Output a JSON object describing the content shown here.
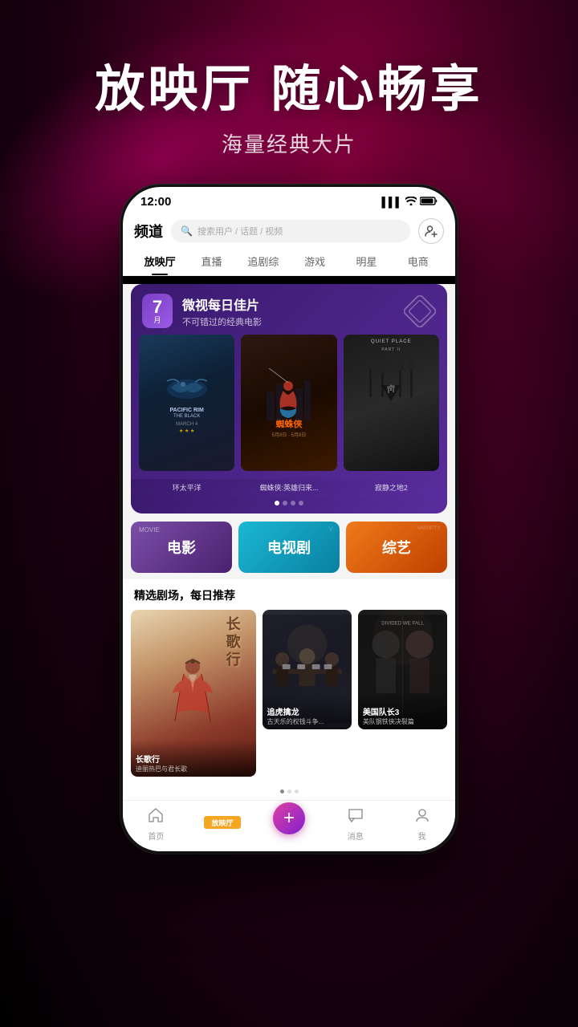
{
  "hero": {
    "title": "放映厅 随心畅享",
    "subtitle": "海量经典大片"
  },
  "phone": {
    "status": {
      "time": "12:00",
      "signal": "▌▌▌",
      "wifi": "WiFi",
      "battery": "🔋"
    },
    "header": {
      "logo": "频道",
      "search_placeholder": "搜索用户 / 话题 / 视频"
    },
    "nav_tabs": [
      {
        "label": "放映厅",
        "active": true
      },
      {
        "label": "直播",
        "active": false
      },
      {
        "label": "追剧综",
        "active": false
      },
      {
        "label": "游戏",
        "active": false
      },
      {
        "label": "明星",
        "active": false
      },
      {
        "label": "电商",
        "active": false
      }
    ],
    "featured": {
      "date_num": "7",
      "date_unit": "月",
      "title": "微视每日佳片",
      "subtitle": "不可错过的经典电影",
      "movies": [
        {
          "title": "PACIFIC RIM\nTHE BLACK",
          "subtitle": "环太平洋",
          "label": "环太平洋"
        },
        {
          "title": "蜘蛛侠",
          "subtitle": "蜘蛛侠:英雄归来...",
          "label": "蜘蛛侠:英雄归来..."
        },
        {
          "title": "QUIET PLACE\nPART II",
          "subtitle": "寂静之地2",
          "label": "寂静之地2"
        }
      ]
    },
    "categories": [
      {
        "label": "电影",
        "overlay": "MOVIE"
      },
      {
        "label": "电视剧",
        "overlay": "V"
      },
      {
        "label": "综艺",
        "overlay": "VARIETY"
      }
    ],
    "drama_section": {
      "title": "精选剧场，每日推荐",
      "items": [
        {
          "name": "长歌行",
          "desc": "迪丽热巴与君长歌",
          "title_overlay": "长歌行"
        },
        {
          "name": "追虎擒龙",
          "desc": "古天乐的权钱斗争..."
        },
        {
          "name": "美国队长3",
          "desc": "美队钢铁侠决裂篇",
          "top_label": "DIVIDED WE FALL"
        }
      ]
    },
    "bottom_nav": [
      {
        "label": "首页",
        "icon": "🏠",
        "active": false
      },
      {
        "label": "放映厅",
        "icon": "📺",
        "active": true
      },
      {
        "label": "+",
        "icon": "+",
        "active": false
      },
      {
        "label": "消息",
        "icon": "💬",
        "active": false
      },
      {
        "label": "我",
        "icon": "👤",
        "active": false
      }
    ]
  }
}
